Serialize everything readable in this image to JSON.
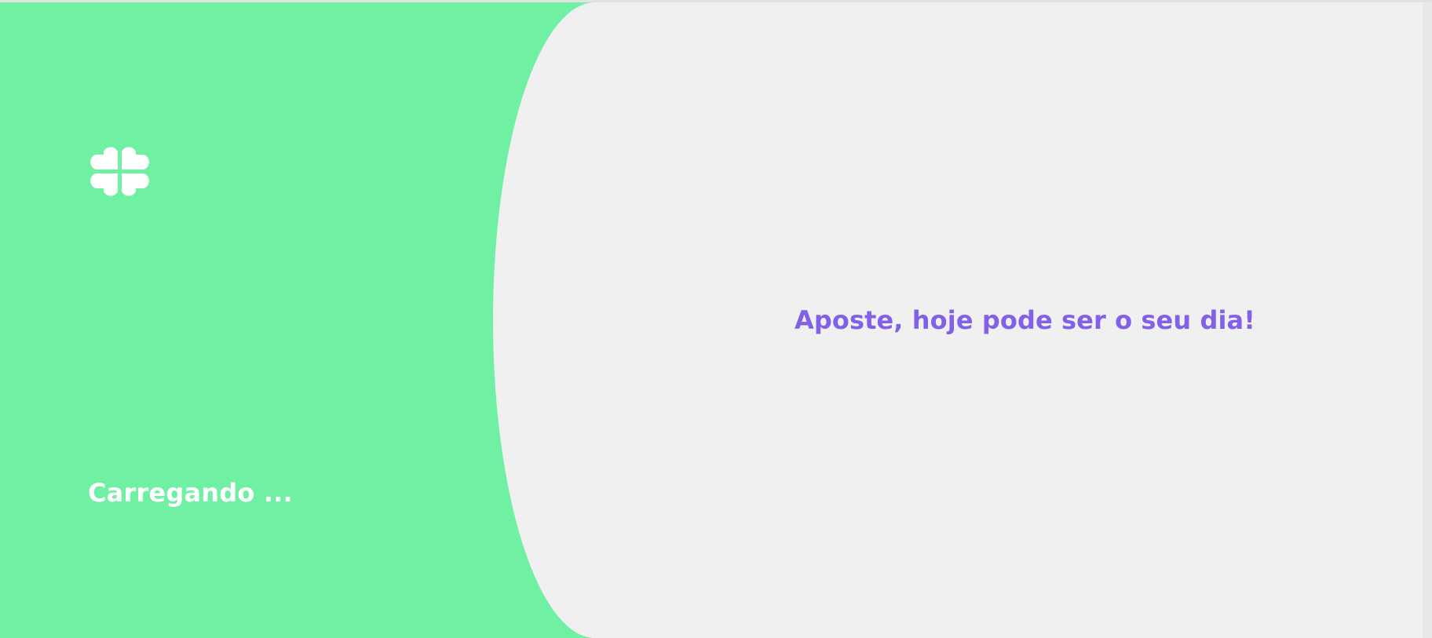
{
  "screen": {
    "loading_text": "Carregando ...",
    "tagline": "Aposte, hoje pode ser o seu dia!"
  },
  "theme": {
    "primary_green": "#6ff0a3",
    "background_gray": "#f0f0f0",
    "accent_purple": "#8260e7",
    "white": "#ffffff"
  },
  "icons": {
    "brand": "clover-icon"
  }
}
